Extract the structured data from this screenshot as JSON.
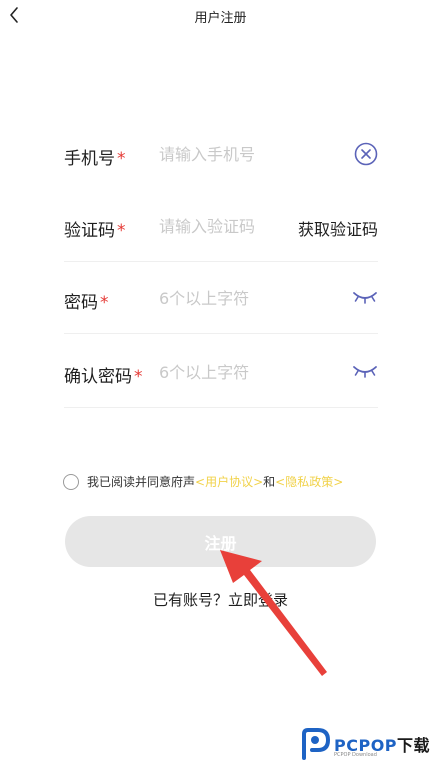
{
  "header": {
    "title": "用户注册"
  },
  "form": {
    "phone": {
      "label": "手机号",
      "required_mark": "*",
      "placeholder": "请输入手机号"
    },
    "code": {
      "label": "验证码",
      "required_mark": "*",
      "placeholder": "请输入验证码",
      "action_label": "获取验证码"
    },
    "password": {
      "label": "密码",
      "required_mark": "*",
      "placeholder": "6个以上字符"
    },
    "confirm": {
      "label": "确认密码",
      "required_mark": "*",
      "placeholder": "6个以上字符"
    }
  },
  "agreement": {
    "prefix": "我已阅读并同意府声",
    "user_agreement": "<用户协议>",
    "joiner": "和",
    "privacy_policy": "<隐私政策>",
    "checked": false
  },
  "register_button": {
    "label": "注册"
  },
  "login_prompt": {
    "question": "已有账号？",
    "action": "立即登录"
  },
  "watermark": {
    "brand_a": "PCPOP",
    "brand_b": "下载",
    "sub": "PCPOP Download"
  },
  "colors": {
    "accent_icon": "#5b63b8",
    "required": "#e53935",
    "link": "#f1d24a",
    "button_bg": "#e6e6e6",
    "annotation_arrow": "#e8403a"
  },
  "icons": [
    "back-chevron-icon",
    "clear-icon",
    "eye-closed-icon",
    "radio-icon",
    "annotation-arrow",
    "pcpop-logo-icon"
  ]
}
